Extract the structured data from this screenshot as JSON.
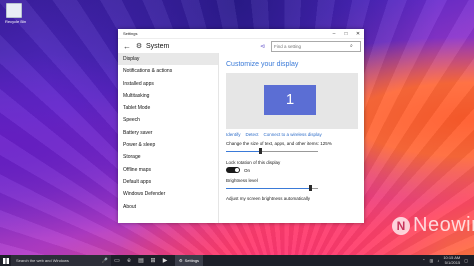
{
  "desktop": {
    "recycle_label": "Recycle Bin",
    "watermark": "Neowin"
  },
  "window": {
    "title": "Settings",
    "controls": [
      "–",
      "□",
      "✕"
    ],
    "section_title": "System",
    "search_placeholder": "Find a setting",
    "sidebar": [
      {
        "label": "Display",
        "active": true
      },
      {
        "label": "Notifications & actions"
      },
      {
        "label": "Installed apps"
      },
      {
        "label": "Multitasking"
      },
      {
        "label": "Tablet Mode"
      },
      {
        "label": "Speech"
      },
      {
        "label": "Battery saver"
      },
      {
        "label": "Power & sleep"
      },
      {
        "label": "Storage"
      },
      {
        "label": "Offline maps"
      },
      {
        "label": "Default apps"
      },
      {
        "label": "Windows Defender"
      },
      {
        "label": "About"
      }
    ],
    "content": {
      "heading": "Customize your display",
      "monitor_number": "1",
      "links": [
        "Identify",
        "Detect",
        "Connect to a wireless display"
      ],
      "scale_text": "Change the size of text, apps, and other items: 125%",
      "scale_value": 0.38,
      "lock_rotation_label": "Lock rotation of this display",
      "toggle_state": "On",
      "brightness_label": "Brightness level",
      "brightness_value": 0.92,
      "auto_brightness_label": "Adjust my screen brightness automatically"
    }
  },
  "taskbar": {
    "search_placeholder": "Search the web and Windows",
    "active_app": "Settings",
    "time": "10:15 AM",
    "date": "5/1/2015"
  },
  "colors": {
    "accent": "#3a7ad8",
    "monitor": "#5b6ed4",
    "taskbar": "#1d1f28"
  }
}
